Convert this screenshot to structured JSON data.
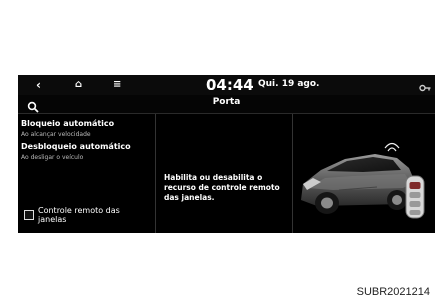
{
  "topbar": {
    "back_icon": "chevron-left-icon",
    "home_icon": "home-icon",
    "menu_icon": "menu-icon",
    "time": "04:44",
    "date": "Qui. 19 ago.",
    "status_icon": "key-icon"
  },
  "header": {
    "search_icon": "search-icon",
    "title": "Porta"
  },
  "options": [
    {
      "label": "Bloqueio automático",
      "sub": "Ao alcançar velocidade"
    },
    {
      "label": "Desbloqueio automático",
      "sub": "Ao desligar o veículo"
    }
  ],
  "remote_window": {
    "label": "Controle remoto das janelas",
    "checked": false
  },
  "description": "Habilita ou desabilita o recurso de controle remoto das janelas.",
  "figure_code": "SUBR2021214"
}
